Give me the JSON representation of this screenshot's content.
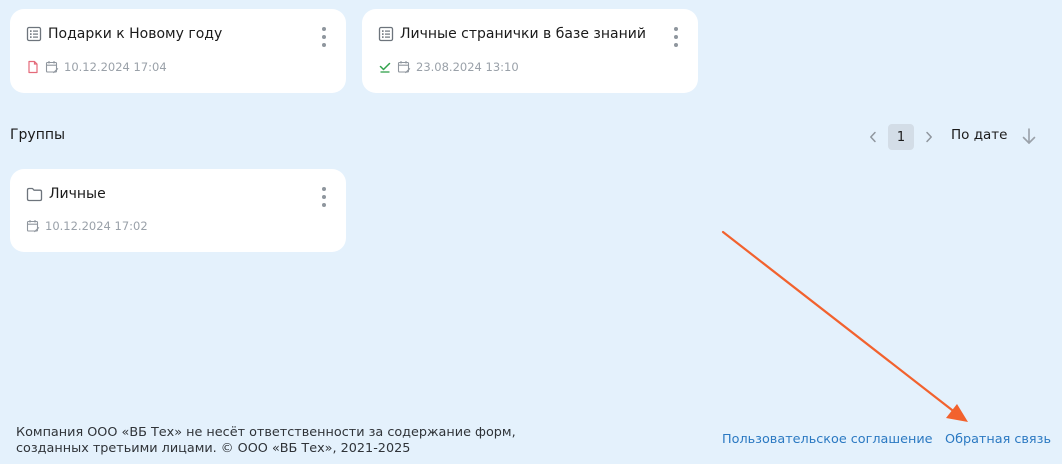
{
  "cards_top": [
    {
      "title": "Подарки к Новому году",
      "status_icon": "file-icon",
      "status_color": "#e46a7a",
      "date": "10.12.2024 17:04"
    },
    {
      "title": "Личные странички в базе знаний",
      "status_icon": "check-icon",
      "status_color": "#31a24c",
      "date": "23.08.2024 13:10"
    }
  ],
  "groups": {
    "title": "Группы",
    "pagination": {
      "current_page": "1"
    },
    "sort_label": "По дате",
    "items": [
      {
        "title": "Личные",
        "icon": "folder-icon",
        "date": "10.12.2024 17:02"
      }
    ]
  },
  "footer": {
    "disclaimer_line1": "Компания ООО «ВБ Тех» не несёт ответственности за содержание форм,",
    "disclaimer_line2": "созданных третьими лицами. © ООО «ВБ Тех», 2021-2025",
    "agreement_link": "Пользовательское соглашение",
    "feedback_link": "Обратная связь"
  },
  "colors": {
    "background": "#e4f1fc",
    "card": "#ffffff",
    "link": "#2b79c2",
    "annotation_arrow": "#f2622e"
  }
}
